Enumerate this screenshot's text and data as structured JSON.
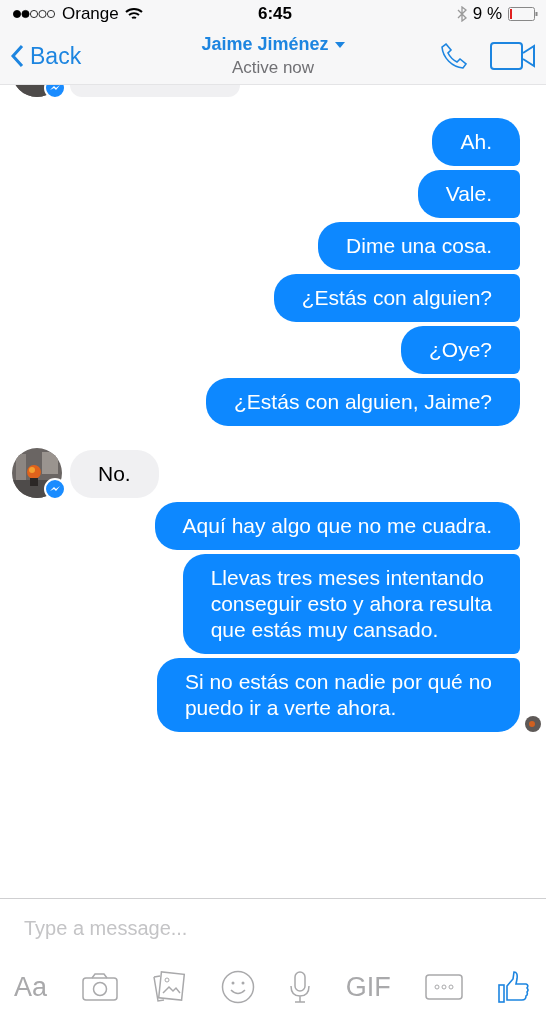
{
  "status_bar": {
    "carrier": "Orange",
    "time": "6:45",
    "battery_percent": "9 %"
  },
  "nav": {
    "back": "Back",
    "title": "Jaime Jiménez",
    "subtitle": "Active now"
  },
  "messages": [
    {
      "kind": "incoming_cut"
    },
    {
      "kind": "outgoing",
      "text": "Ah."
    },
    {
      "kind": "outgoing",
      "text": "Vale."
    },
    {
      "kind": "outgoing",
      "text": "Dime una cosa."
    },
    {
      "kind": "outgoing",
      "text": "¿Estás con alguien?"
    },
    {
      "kind": "outgoing",
      "text": "¿Oye?"
    },
    {
      "kind": "outgoing",
      "text": "¿Estás con alguien, Jaime?"
    },
    {
      "kind": "incoming",
      "text": "No."
    },
    {
      "kind": "outgoing",
      "text": "Aquí hay algo que no me cuadra."
    },
    {
      "kind": "outgoing",
      "text": "Llevas tres meses intentando\nconseguir esto y ahora resulta\nque estás muy cansado."
    },
    {
      "kind": "outgoing",
      "text": "Si no estás con nadie por qué no\npuedo ir a verte ahora.",
      "seen": true
    }
  ],
  "composer": {
    "placeholder": "Type a message...",
    "text_button": "Aa",
    "gif_button": "GIF"
  }
}
